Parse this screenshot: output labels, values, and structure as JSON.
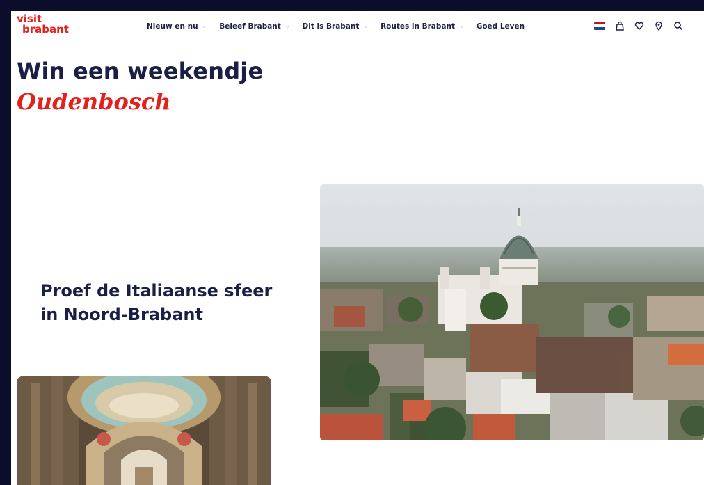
{
  "brand": {
    "logo_line1": "visit",
    "logo_line2": "brabant",
    "color": "#e3201b"
  },
  "nav": {
    "items": [
      {
        "label": "Nieuw en nu",
        "dropdown": true
      },
      {
        "label": "Beleef Brabant",
        "dropdown": true
      },
      {
        "label": "Dit is Brabant",
        "dropdown": true
      },
      {
        "label": "Routes in Brabant",
        "dropdown": true
      },
      {
        "label": "Goed Leven",
        "dropdown": false
      }
    ],
    "utility_icons": [
      "dutch-flag-icon",
      "bag-icon",
      "heart-icon",
      "location-pin-icon",
      "search-icon"
    ]
  },
  "hero": {
    "title_line1": "Win een weekendje",
    "title_accent": "Oudenbosch"
  },
  "section": {
    "subheading": "Proef de Italiaanse sfeer in Noord-Brabant"
  },
  "images": {
    "main": "aerial-view-oudenbosch-basilica",
    "secondary": "basilica-interior-dome"
  },
  "colors": {
    "navy": "#1c1f45",
    "red": "#e3201b",
    "background": "#0a0e2a"
  }
}
